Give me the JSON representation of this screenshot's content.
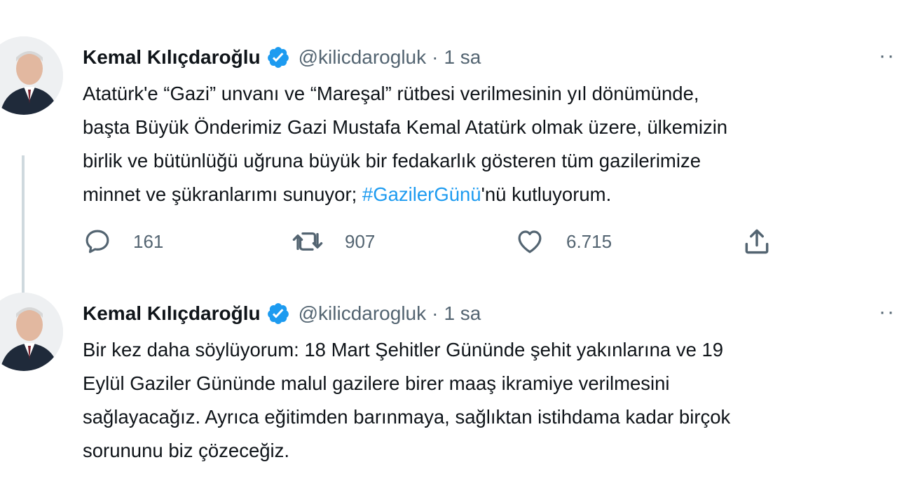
{
  "tweets": [
    {
      "author": {
        "name": "Kemal Kılıçdaroğlu",
        "handle": "@kilicdarogluk",
        "time": "1 sa"
      },
      "text_lines": [
        "Atatürk'e “Gazi” unvanı ve “Mareşal” rütbesi verilmesinin yıl dönümünde,",
        "başta Büyük Önderimiz Gazi Mustafa Kemal Atatürk olmak üzere, ülkemizin",
        "birlik ve bütünlüğü uğruna büyük bir fedakarlık gösteren tüm gazilerimize"
      ],
      "last_line": {
        "before": "minnet ve şükranlarımı sunuyor; ",
        "hashtag": "#GazilerGünü",
        "after": "'nü kutluyorum."
      },
      "stats": {
        "replies": "161",
        "retweets": "907",
        "likes": "6.715"
      }
    },
    {
      "author": {
        "name": "Kemal Kılıçdaroğlu",
        "handle": "@kilicdarogluk",
        "time": "1 sa"
      },
      "text_lines": [
        "Bir kez daha söylüyorum: 18 Mart Şehitler Gününde şehit yakınlarına ve 19",
        "Eylül Gaziler Gününde malul gazilere birer maaş ikramiye verilmesini",
        "sağlayacağız. Ayrıca eğitimden barınmaya, sağlıktan istihdama kadar birçok",
        "sorununu biz çözeceğiz."
      ]
    }
  ],
  "separator": "·",
  "more_label": "···",
  "icons": {
    "verified": "verified-badge-icon",
    "reply": "reply-icon",
    "retweet": "retweet-icon",
    "like": "heart-icon",
    "share": "share-icon",
    "more": "more-icon"
  },
  "colors": {
    "verified": "#1d9bf0",
    "hashtag": "#1d9bf0",
    "secondary_text": "#536471"
  }
}
